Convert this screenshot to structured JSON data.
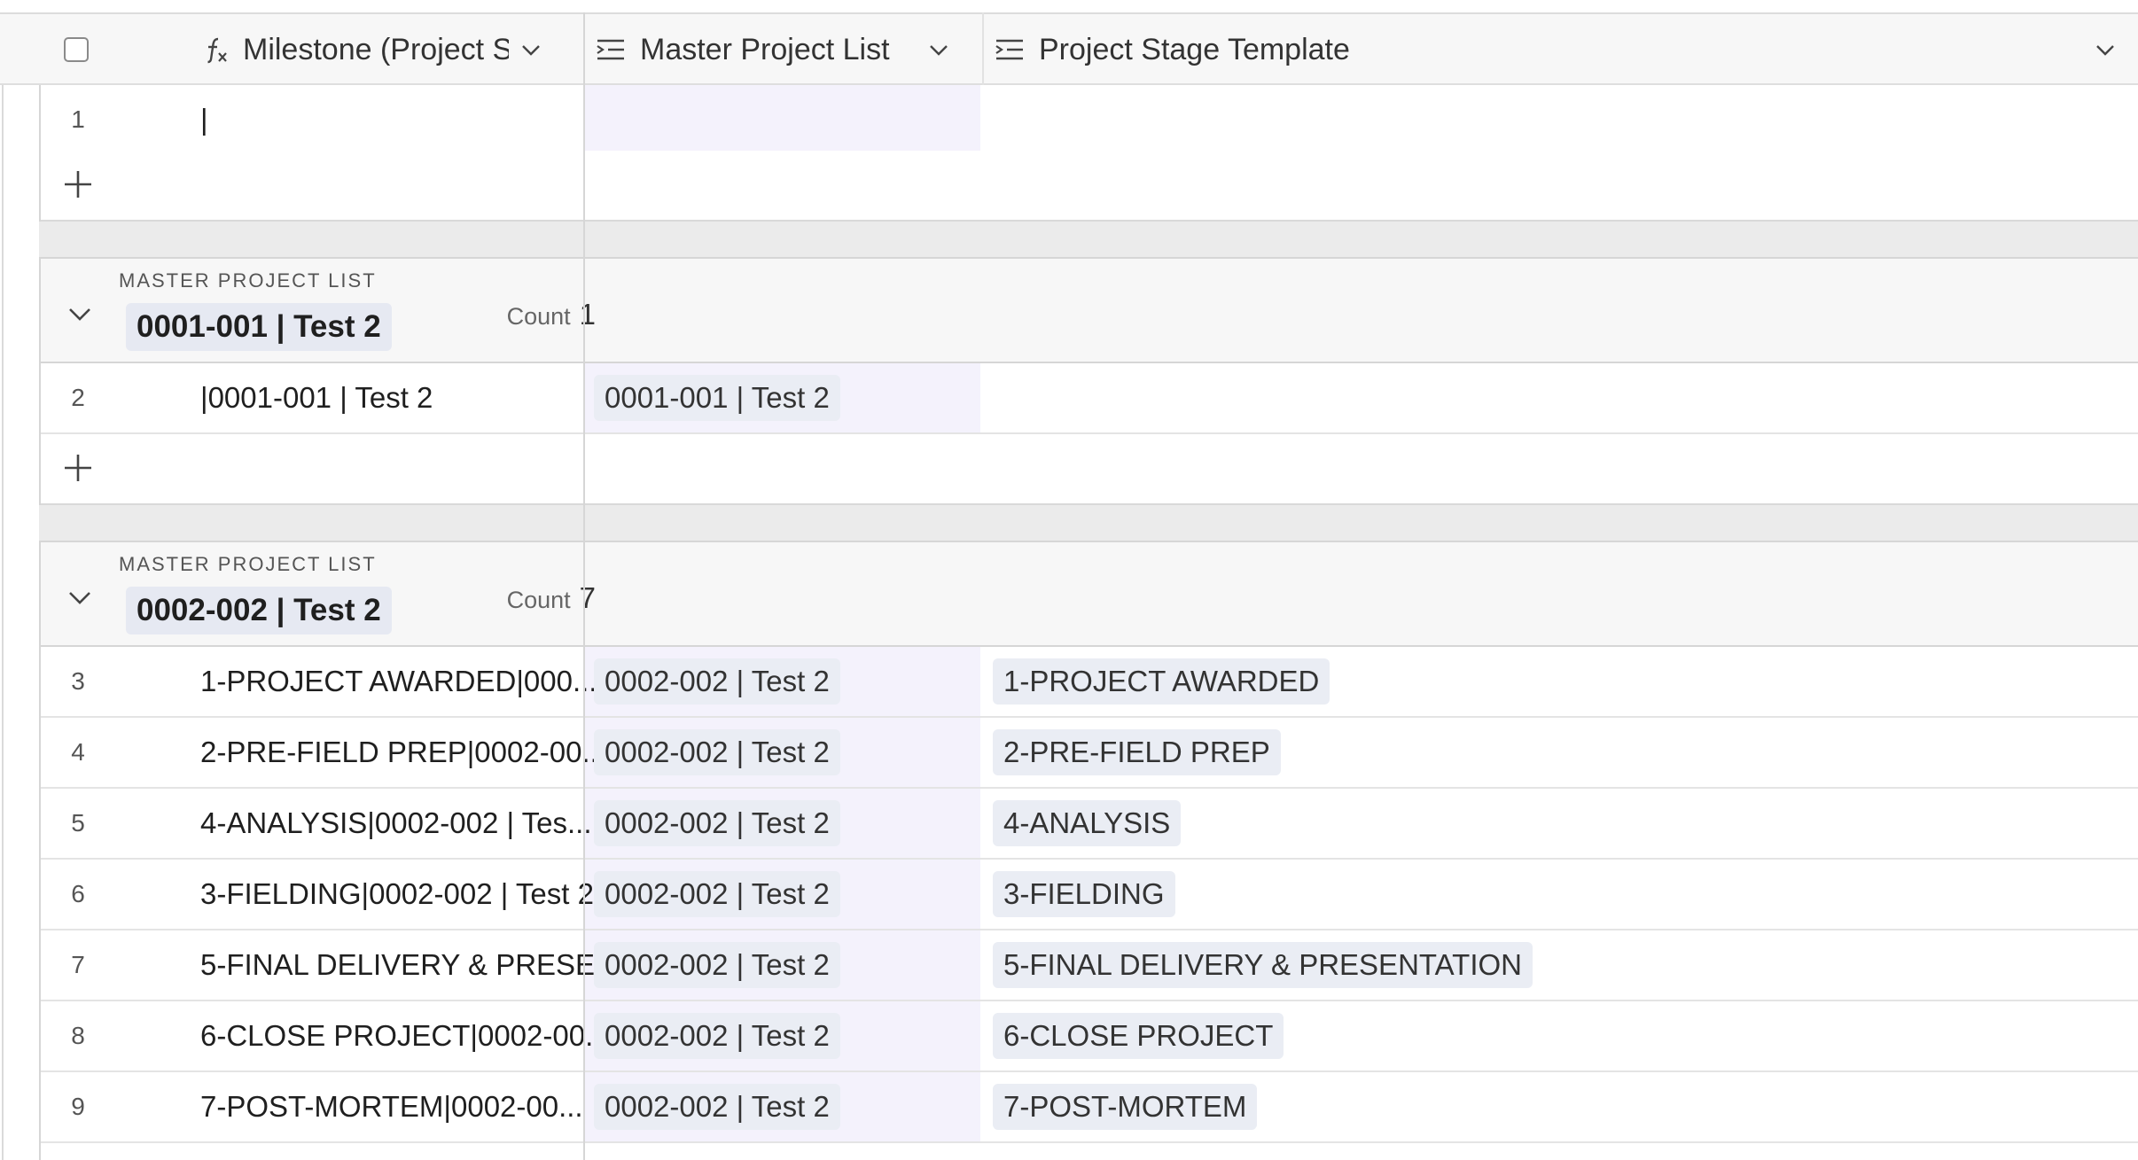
{
  "header": {
    "columns": [
      {
        "label": "Milestone (Project St...",
        "icon": "formula-icon"
      },
      {
        "label": "Master Project List",
        "icon": "link-field-icon"
      },
      {
        "label": "Project Stage Template",
        "icon": "link-field-icon"
      }
    ]
  },
  "ungrouped": {
    "rows": [
      {
        "num": "1",
        "milestone": "|",
        "master": "",
        "stage": ""
      }
    ]
  },
  "groups": [
    {
      "field_label": "MASTER PROJECT LIST",
      "value": "0001-001 | Test 2",
      "count_label": "Count",
      "count": "1",
      "rows": [
        {
          "num": "2",
          "milestone": "|0001-001 | Test 2",
          "master": "0001-001 | Test 2",
          "stage": ""
        }
      ]
    },
    {
      "field_label": "MASTER PROJECT LIST",
      "value": "0002-002 | Test 2",
      "count_label": "Count",
      "count": "7",
      "rows": [
        {
          "num": "3",
          "milestone": "1-PROJECT AWARDED|000...",
          "master": "0002-002 | Test 2",
          "stage": "1-PROJECT AWARDED"
        },
        {
          "num": "4",
          "milestone": "2-PRE-FIELD PREP|0002-00...",
          "master": "0002-002 | Test 2",
          "stage": "2-PRE-FIELD PREP"
        },
        {
          "num": "5",
          "milestone": "4-ANALYSIS|0002-002 | Tes...",
          "master": "0002-002 | Test 2",
          "stage": "4-ANALYSIS"
        },
        {
          "num": "6",
          "milestone": "3-FIELDING|0002-002 | Test 2",
          "master": "0002-002 | Test 2",
          "stage": "3-FIELDING"
        },
        {
          "num": "7",
          "milestone": "5-FINAL DELIVERY & PRESE...",
          "master": "0002-002 | Test 2",
          "stage": "5-FINAL DELIVERY & PRESENTATION"
        },
        {
          "num": "8",
          "milestone": "6-CLOSE PROJECT|0002-00...",
          "master": "0002-002 | Test 2",
          "stage": "6-CLOSE PROJECT"
        },
        {
          "num": "9",
          "milestone": "7-POST-MORTEM|0002-00...",
          "master": "0002-002 | Test 2",
          "stage": "7-POST-MORTEM"
        }
      ]
    }
  ],
  "colors": {
    "selected_column_bg": "#f4f2fc",
    "chip_bg": "#eaedf4",
    "header_bg": "#f7f7f7"
  }
}
